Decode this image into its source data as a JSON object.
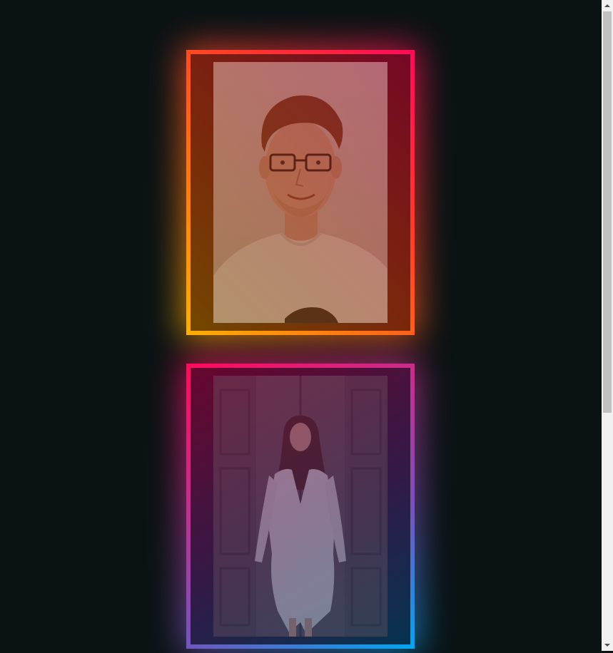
{
  "page": {
    "background_color": "#0a1214"
  },
  "cards": [
    {
      "image": "portrait-man-glasses",
      "gradient_colors": [
        "#ff0a5a",
        "#ff3a2a",
        "#ff7a10",
        "#ffb000"
      ]
    },
    {
      "image": "portrait-woman-white-dress",
      "gradient_colors": [
        "#ff0a5a",
        "#c23090",
        "#7a50b8",
        "#00a6f0"
      ]
    }
  ],
  "scrollbar": {
    "up_icon": "arrow-up-icon",
    "down_icon": "arrow-down-icon"
  }
}
